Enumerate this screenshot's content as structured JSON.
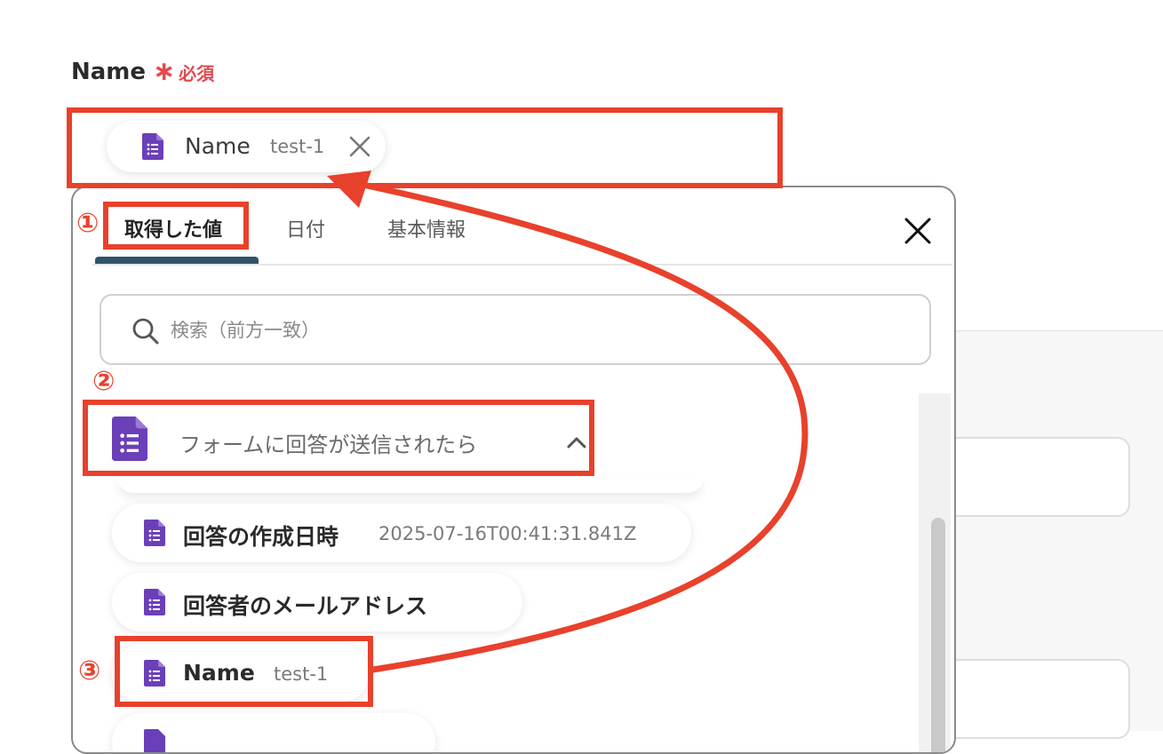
{
  "field": {
    "label": "Name",
    "required_mark": "∗",
    "required_text": "必須"
  },
  "selected_chip": {
    "name": "Name",
    "value": "test-1"
  },
  "popup": {
    "tabs": [
      {
        "label": "取得した値",
        "active": true
      },
      {
        "label": "日付",
        "active": false
      },
      {
        "label": "基本情報",
        "active": false
      }
    ],
    "search_placeholder": "検索（前方一致）",
    "group": {
      "title": "フォームに回答が送信されたら",
      "expanded": true
    },
    "items": [
      {
        "label": "回答の作成日時",
        "value": "2025-07-16T00:41:31.841Z"
      },
      {
        "label": "回答者のメールアドレス",
        "value": ""
      },
      {
        "label": "Name",
        "value": "test-1"
      }
    ]
  },
  "annotations": {
    "step1": "①",
    "step2": "②",
    "step3": "③"
  },
  "colors": {
    "accent_red": "#e8412c",
    "forms_purple": "#6b3fb8",
    "tab_underline": "#2f5468",
    "required": "#e5484d"
  },
  "icons": [
    "google-forms-icon",
    "close-icon",
    "search-icon",
    "chevron-up-icon"
  ]
}
